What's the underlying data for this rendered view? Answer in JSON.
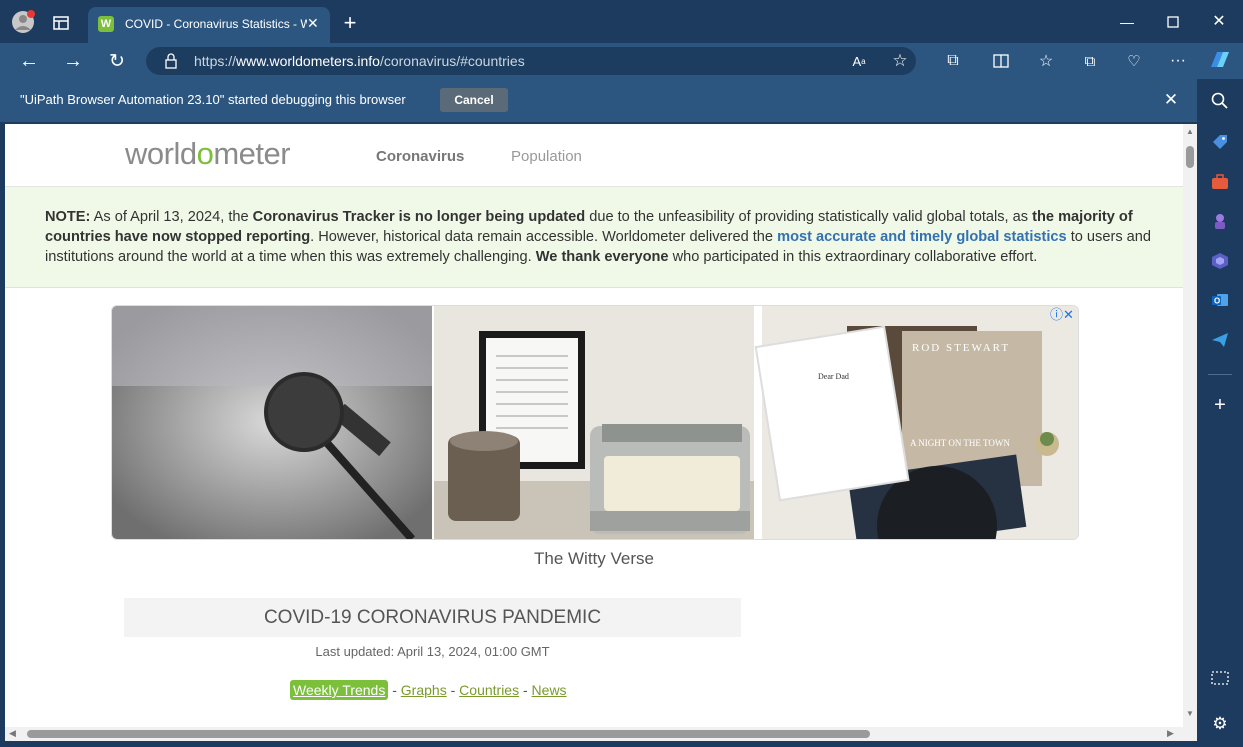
{
  "browser": {
    "tab_title": "COVID - Coronavirus Statistics - Wo",
    "tab_favicon_letter": "W",
    "url_prefix": "https://",
    "url_domain": "www.worldometers.info",
    "url_path": "/coronavirus/#countries",
    "infobar_text": "\"UiPath Browser Automation 23.10\" started debugging this browser",
    "infobar_cancel": "Cancel"
  },
  "site": {
    "logo_start": "worldo",
    "logo_o": "",
    "logo_end": "meter",
    "nav": [
      "Coronavirus",
      "Population"
    ]
  },
  "note": {
    "label": "NOTE:",
    "part1": " As of April 13, 2024, the ",
    "bold1": "Coronavirus Tracker is no longer being updated",
    "part2": " due to the unfeasibility of providing statistically valid global totals, as ",
    "bold2": "the majority of countries have now stopped reporting",
    "part3": ". However, historical data remain accessible. Worldometer delivered the ",
    "link": "most accurate and timely global statistics",
    "part4": " to users and institutions around the world at a time when this was extremely challenging. ",
    "bold3": "We thank everyone",
    "part5": " who participated in this extraordinary collaborative effort."
  },
  "ad": {
    "caption": "The Witty Verse",
    "frame_title": "Dear Dad",
    "album_text": "ROD STEWART",
    "album_sub": "A NIGHT ON THE TOWN"
  },
  "main": {
    "pandemic_title": "COVID-19 CORONAVIRUS PANDEMIC",
    "last_updated": "Last updated: April 13, 2024, 01:00 GMT",
    "links": [
      "Weekly Trends",
      "Graphs",
      "Countries",
      "News"
    ],
    "sep": " - "
  },
  "colors": {
    "brand_green": "#7bbf3a",
    "note_bg": "#f0f9e8",
    "browser_frame": "#1c3b5e"
  }
}
